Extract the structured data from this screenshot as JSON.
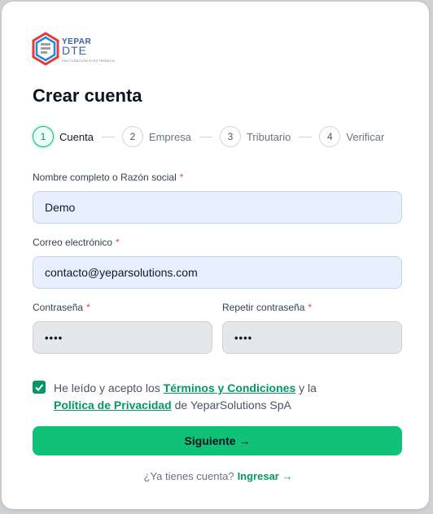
{
  "logo": {
    "brand_top": "YEPAR",
    "brand_main": "DTE",
    "brand_sub": "FACTURACIÓN ELECTRÓNICA"
  },
  "page_title": "Crear cuenta",
  "steps": [
    {
      "number": "1",
      "label": "Cuenta",
      "active": true
    },
    {
      "number": "2",
      "label": "Empresa",
      "active": false
    },
    {
      "number": "3",
      "label": "Tributario",
      "active": false
    },
    {
      "number": "4",
      "label": "Verificar",
      "active": false
    }
  ],
  "form": {
    "name_label": "Nombre completo o Razón social",
    "name_value": "Demo",
    "email_label": "Correo electrónico",
    "email_value": "contacto@yeparsolutions.com",
    "password_label": "Contraseña",
    "password_value": "••••",
    "repeat_password_label": "Repetir contraseña",
    "repeat_password_value": "••••",
    "required_mark": "*"
  },
  "terms": {
    "checked": true,
    "prefix": "He leído y acepto los",
    "terms_link": "Términos y Condiciones",
    "middle": "y la",
    "privacy_link": "Política de Privacidad",
    "suffix": "de YeparSolutions SpA"
  },
  "submit_label": "Siguiente →",
  "footer": {
    "question": "¿Ya tienes cuenta?",
    "login_link": "Ingresar →"
  },
  "colors": {
    "accent": "#10c277",
    "accent_dark": "#059669",
    "required": "#ef4444",
    "input_bg": "#e8f0fe"
  }
}
